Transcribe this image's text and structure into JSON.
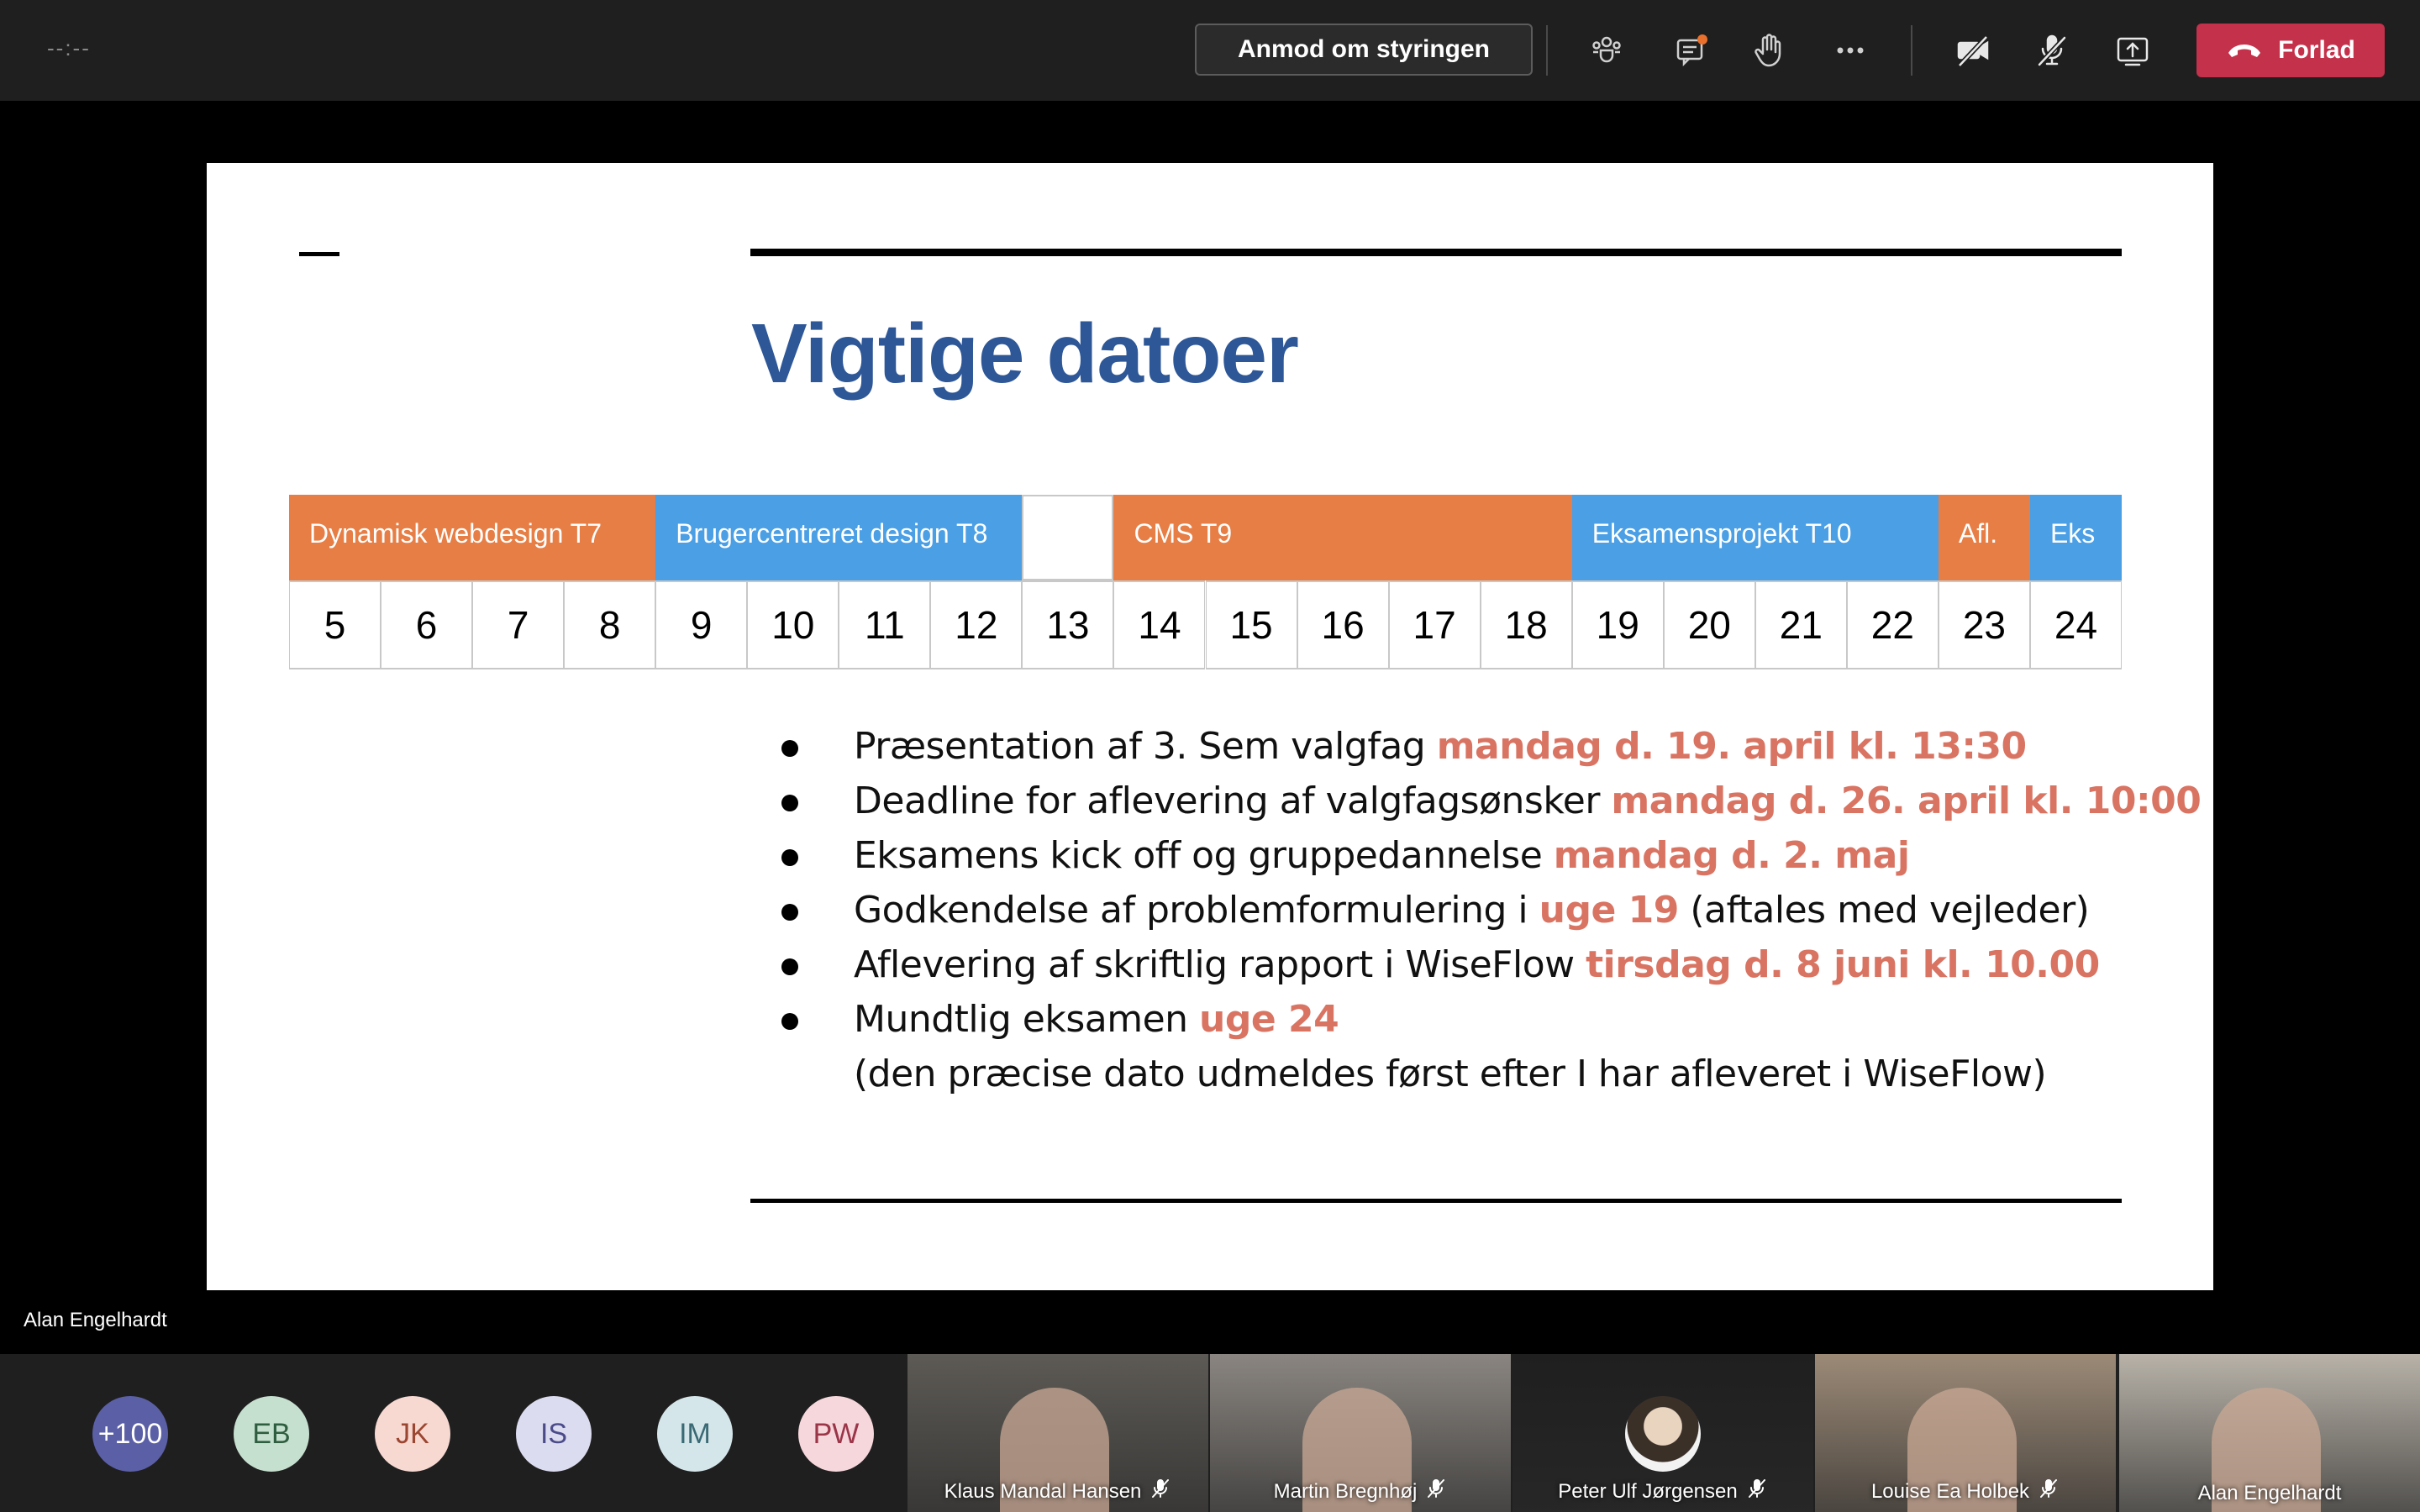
{
  "topbar": {
    "timer": "--:--",
    "request_control_label": "Anmod om styringen",
    "leave_label": "Forlad",
    "icons": [
      "participants-icon",
      "chat-icon",
      "raise-hand-icon",
      "more-icon",
      "camera-off-icon",
      "mic-off-icon",
      "share-screen-icon",
      "phone-hangup-icon"
    ],
    "colors": {
      "leave_button": "#c4314b",
      "chat_badge": "#e9712d"
    }
  },
  "slide": {
    "title": "Vigtige datoer",
    "colors": {
      "title": "#2e5797",
      "orange": "#e67e45",
      "blue": "#4b9fe5",
      "highlight": "#d97463"
    },
    "phases": [
      {
        "label": "Dynamisk webdesign T7",
        "color": "orange",
        "weeks": 4
      },
      {
        "label": "Brugercentreret design T8",
        "color": "blue",
        "weeks": 4
      },
      {
        "label": "",
        "color": "empty",
        "weeks": 1
      },
      {
        "label": "CMS  T9",
        "color": "orange",
        "weeks": 5
      },
      {
        "label": "Eksamensprojekt T10",
        "color": "blue",
        "weeks": 4
      },
      {
        "label": "Afl.",
        "color": "orange",
        "weeks": 1
      },
      {
        "label": "Eks",
        "color": "blue",
        "weeks": 1
      }
    ],
    "weeks": [
      "5",
      "6",
      "7",
      "8",
      "9",
      "10",
      "11",
      "12",
      "13",
      "14",
      "15",
      "16",
      "17",
      "18",
      "19",
      "20",
      "21",
      "22",
      "23",
      "24"
    ],
    "bullets": [
      {
        "text": "Præsentation af 3. Sem valgfag ",
        "highlight": "mandag d. 19. april  kl. 13:30",
        "after": ""
      },
      {
        "text": "Deadline for aflevering af valgfagsønsker ",
        "highlight": "mandag d. 26. april  kl. 10:00",
        "after": ""
      },
      {
        "text": "Eksamens kick off og gruppedannelse ",
        "highlight": "mandag d. 2. maj",
        "after": ""
      },
      {
        "text": "Godkendelse af problemformulering i ",
        "highlight": "uge 19",
        "after": " (aftales med vejleder)"
      },
      {
        "text": "Aflevering af skriftlig rapport i WiseFlow ",
        "highlight": "tirsdag d. 8 juni kl. 10.00",
        "after": ""
      },
      {
        "text": "Mundtlig eksamen ",
        "highlight": "uge 24",
        "after": ""
      }
    ],
    "note": "(den præcise dato udmeldes først efter I har afleveret i WiseFlow)"
  },
  "speaker_name": "Alan Engelhardt",
  "gallery": {
    "avatars": [
      {
        "initials": "+100",
        "bg": "#5b5fa6",
        "fg": "#ffffff"
      },
      {
        "initials": "EB",
        "bg": "#c6e0cf",
        "fg": "#2f5d3f"
      },
      {
        "initials": "JK",
        "bg": "#f7d9d2",
        "fg": "#9b4630"
      },
      {
        "initials": "IS",
        "bg": "#dcdcf0",
        "fg": "#4b4b8a"
      },
      {
        "initials": "IM",
        "bg": "#d5e6ea",
        "fg": "#3a6a75"
      },
      {
        "initials": "PW",
        "bg": "#f6d7dc",
        "fg": "#9b3548"
      }
    ],
    "videos": [
      {
        "name": "Klaus Mandal Hansen",
        "muted": true,
        "bg": "#5d5a55"
      },
      {
        "name": "Martin Bregnhøj",
        "muted": true,
        "bg": "#8a8580"
      },
      {
        "name": "Peter Ulf Jørgensen",
        "muted": true,
        "bg": "#1f1f1f"
      },
      {
        "name": "Louise Ea Holbek",
        "muted": true,
        "bg": "#9c8a77"
      },
      {
        "name": "Alan Engelhardt",
        "muted": false,
        "bg": "#b8b2a8"
      }
    ]
  }
}
